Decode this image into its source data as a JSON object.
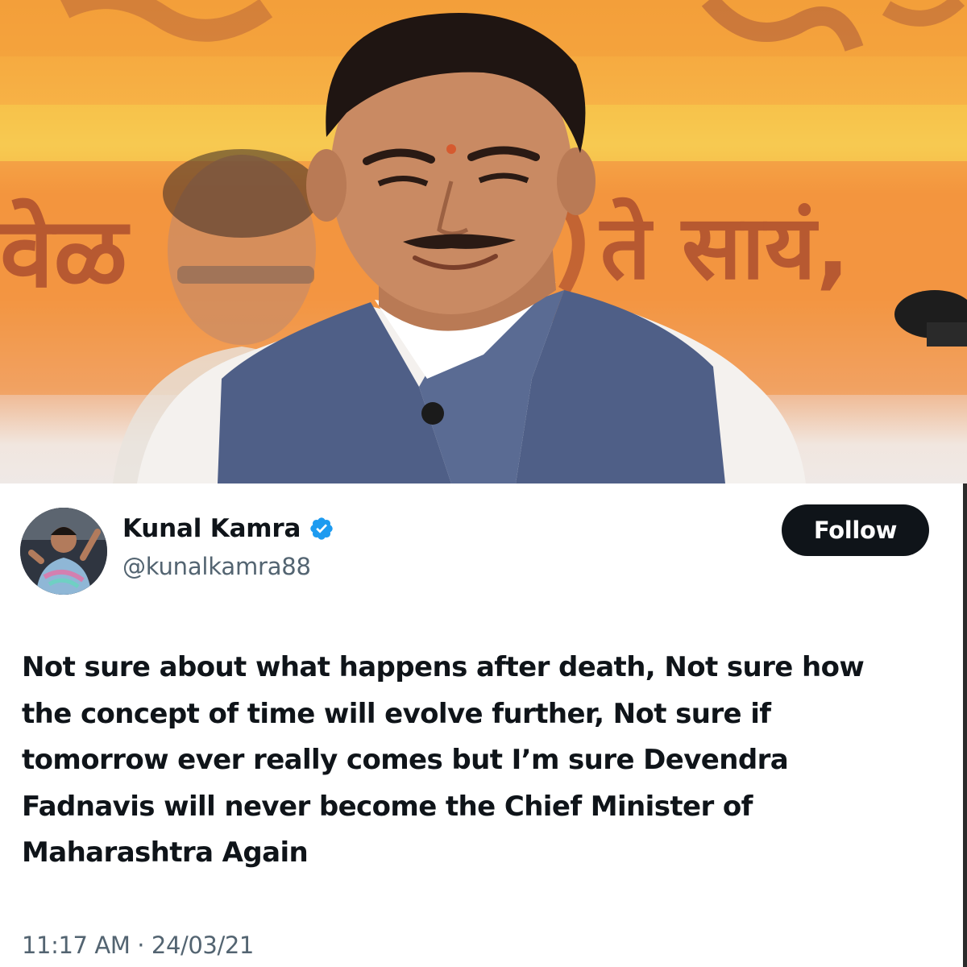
{
  "photo": {
    "alt_icon": "person-photo",
    "banner_text_left": "वेळ",
    "banner_text_right": "ते सायं,"
  },
  "tweet": {
    "author": {
      "name": "Kunal Kamra",
      "handle": "@kunalkamra88",
      "verified": true,
      "avatar_icon": "avatar-photo"
    },
    "follow_label": "Follow",
    "text_lines": [
      "Not sure about what happens after death, Not sure how",
      "the concept of time will evolve further, Not sure if",
      "tomorrow ever really comes but I’m sure Devendra",
      "Fadnavis will never become the Chief Minister of",
      "Maharashtra Again"
    ],
    "timestamp": "11:17 AM · 24/03/21"
  },
  "colors": {
    "text_primary": "#0f1419",
    "text_secondary": "#536471",
    "verified_blue": "#1d9bf0",
    "button_bg": "#0f1419",
    "button_text": "#ffffff"
  }
}
